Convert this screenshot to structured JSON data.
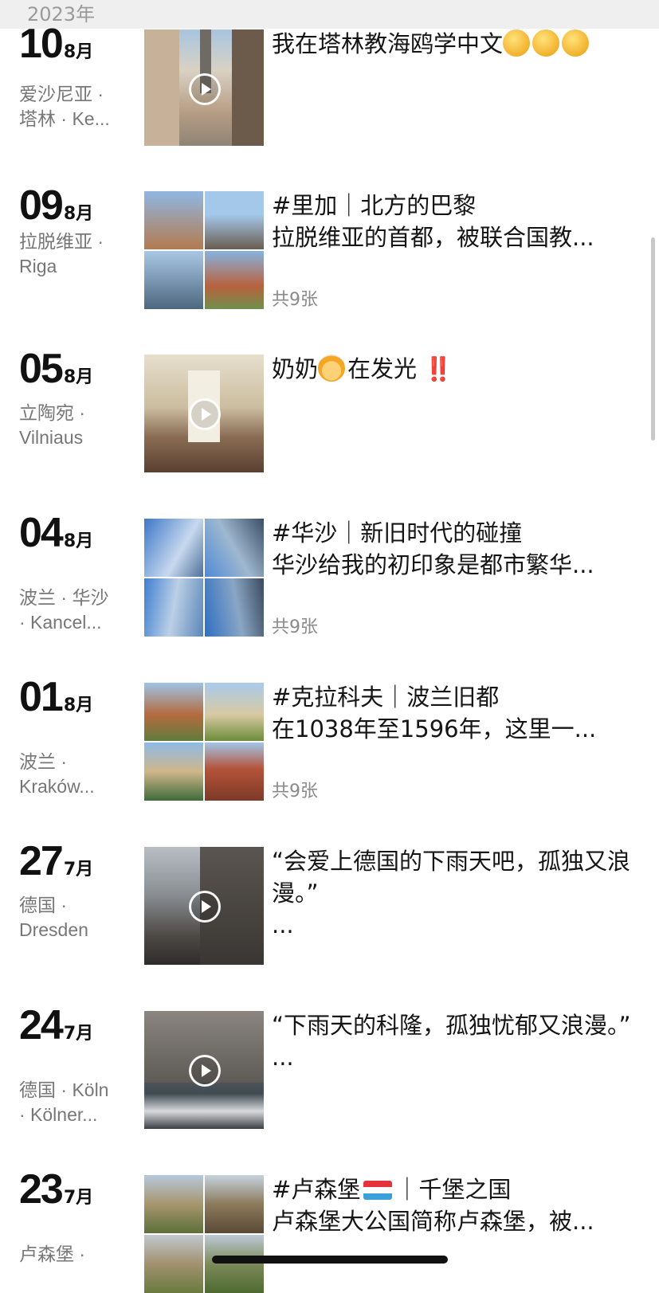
{
  "year_label": "2023年",
  "count_suffix_note": "",
  "posts": [
    {
      "day": "10",
      "month": "8月",
      "loc1": "爱沙尼亚 ·",
      "loc2": "塔林 · Ke...",
      "text1": "我在塔林教海鸥学中文",
      "text2": "",
      "count": "",
      "media": "video"
    },
    {
      "day": "09",
      "month": "8月",
      "loc1": "拉脱维亚 ·",
      "loc2": "Riga",
      "text1": "#里加｜北方的巴黎",
      "text2": "拉脱维亚的首都，被联合国教...",
      "count": "共9张",
      "media": "grid"
    },
    {
      "day": "05",
      "month": "8月",
      "loc1": "立陶宛 ·",
      "loc2": "Vilniaus",
      "text1": "奶奶",
      "text1b": "在发光",
      "bang": "‼️",
      "text2": "",
      "count": "",
      "media": "video"
    },
    {
      "day": "04",
      "month": "8月",
      "loc1": "波兰 · 华沙",
      "loc2": "· Kancel...",
      "text1": "#华沙｜新旧时代的碰撞",
      "text2": "华沙给我的初印象是都市繁华...",
      "count": "共9张",
      "media": "grid"
    },
    {
      "day": "01",
      "month": "8月",
      "loc1": "波兰 ·",
      "loc2": "Kraków...",
      "text1": "#克拉科夫｜波兰旧都",
      "text2": "在1038年至1596年，这里一...",
      "count": "共9张",
      "media": "grid"
    },
    {
      "day": "27",
      "month": "7月",
      "loc1": "德国 ·",
      "loc2": "Dresden",
      "text1": "“会爱上德国的下雨天吧，孤独又浪漫。”",
      "text2": "...",
      "count": "",
      "media": "video"
    },
    {
      "day": "24",
      "month": "7月",
      "loc1": "德国 · Köln",
      "loc2": "· Kölner...",
      "text1": "“下雨天的科隆，孤独忧郁又浪漫。”",
      "text2": "...",
      "count": "",
      "media": "video"
    },
    {
      "day": "23",
      "month": "7月",
      "loc1": "卢森堡 ·",
      "loc2": "",
      "text1": "#卢森堡",
      "text1b": "｜千堡之国",
      "text2": "卢森堡大公国简称卢森堡，被...",
      "count": "",
      "media": "grid"
    }
  ],
  "colors": {
    "text": "#151515",
    "muted": "#777777",
    "count": "#8a8a8a",
    "bar": "#efefef"
  }
}
